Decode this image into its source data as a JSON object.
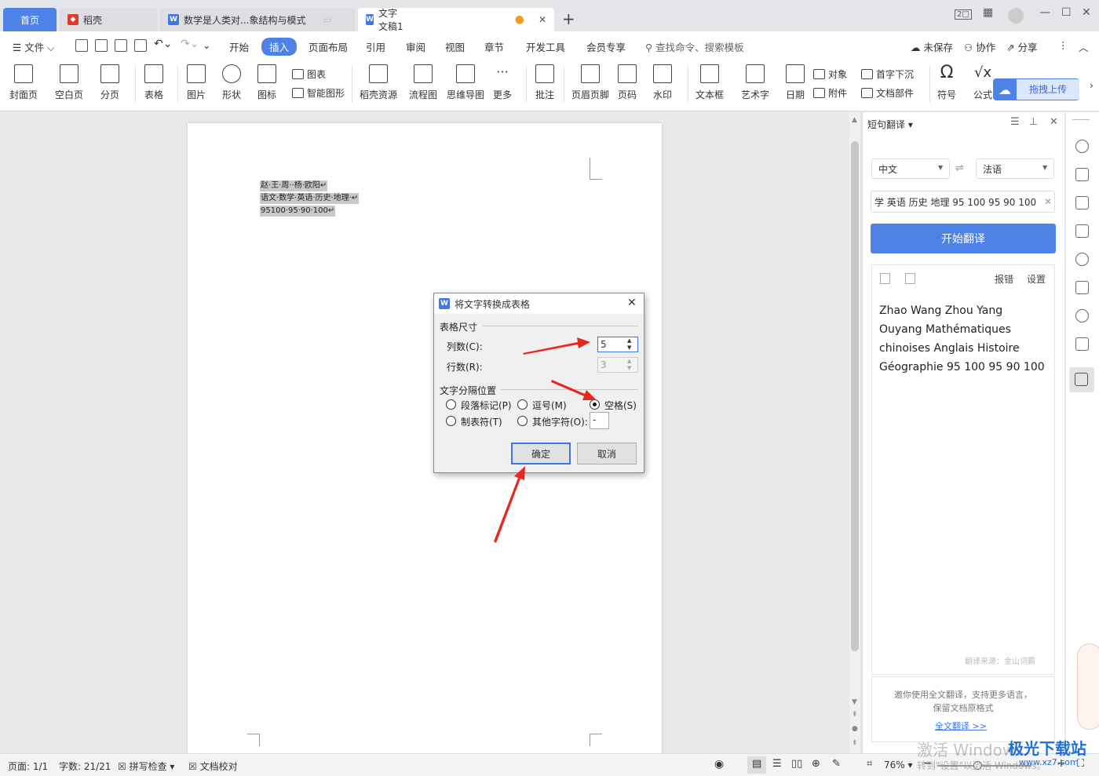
{
  "tabs": {
    "home": "首页",
    "daoke": "稻壳",
    "doc1": "数学是人类对...象结构与模式",
    "doc2": "文字文稿1"
  },
  "menu": {
    "file": "文件",
    "items": [
      "开始",
      "插入",
      "页面布局",
      "引用",
      "审阅",
      "视图",
      "章节",
      "开发工具",
      "会员专享"
    ],
    "search": "查找命令、搜索模板",
    "unsaved": "未保存",
    "collab": "协作",
    "share": "分享"
  },
  "ribbon": {
    "cover": "封面页",
    "blank": "空白页",
    "pagebreak": "分页",
    "table": "表格",
    "picture": "图片",
    "shape": "形状",
    "icon": "图标",
    "chart": "图表",
    "smartart": "智能图形",
    "daoke_res": "稻壳资源",
    "flowchart": "流程图",
    "mindmap": "思维导图",
    "more": "更多",
    "comment": "批注",
    "header_footer": "页眉页脚",
    "page_number": "页码",
    "watermark": "水印",
    "textbox": "文本框",
    "wordart": "艺术字",
    "date": "日期",
    "object": "对象",
    "dropcap": "首字下沉",
    "attachment": "附件",
    "docparts": "文档部件",
    "symbol": "符号",
    "formula": "公式",
    "upload": "拖拽上传"
  },
  "document": {
    "lines": [
      "赵·王·周··杨·欧阳↵",
      "语文·数学·英语·历史·地理·↵",
      "95100·95·90·100↵"
    ]
  },
  "dialog": {
    "title": "将文字转换成表格",
    "section_size": "表格尺寸",
    "cols_label": "列数(C):",
    "cols_value": "5",
    "rows_label": "行数(R):",
    "rows_value": "3",
    "section_sep": "文字分隔位置",
    "opt_para": "段落标记(P)",
    "opt_comma": "逗号(M)",
    "opt_space": "空格(S)",
    "opt_tab": "制表符(T)",
    "opt_other": "其他字符(O):",
    "other_value": "-",
    "ok": "确定",
    "cancel": "取消"
  },
  "panel": {
    "title": "短句翻译",
    "src_lang": "中文",
    "dst_lang": "法语",
    "input": "学 英语 历史 地理  95 100 95 90 100",
    "translate_btn": "开始翻译",
    "report": "报错",
    "settings": "设置",
    "result": "Zhao Wang Zhou Yang Ouyang Mathématiques chinoises Anglais Histoire Géographie 95 100 95 90 100",
    "source": "翻译来源：金山词霸",
    "promo": "邀你使用全文翻译，支持更多语言，保留文档原格式",
    "full_link": "全文翻译 >>"
  },
  "status": {
    "page": "页面: 1/1",
    "words": "字数: 21/21",
    "spell": "拼写检查",
    "proof": "文档校对",
    "zoom": "76%"
  },
  "watermarks": {
    "activate": "激活 Windows",
    "activate2": "转到\"设置\"以激活 Windows。",
    "site": "极光下载站",
    "site_url": "www.xz7.com"
  },
  "colors": {
    "accent": "#4e82e6",
    "arrow": "#e8271e"
  }
}
